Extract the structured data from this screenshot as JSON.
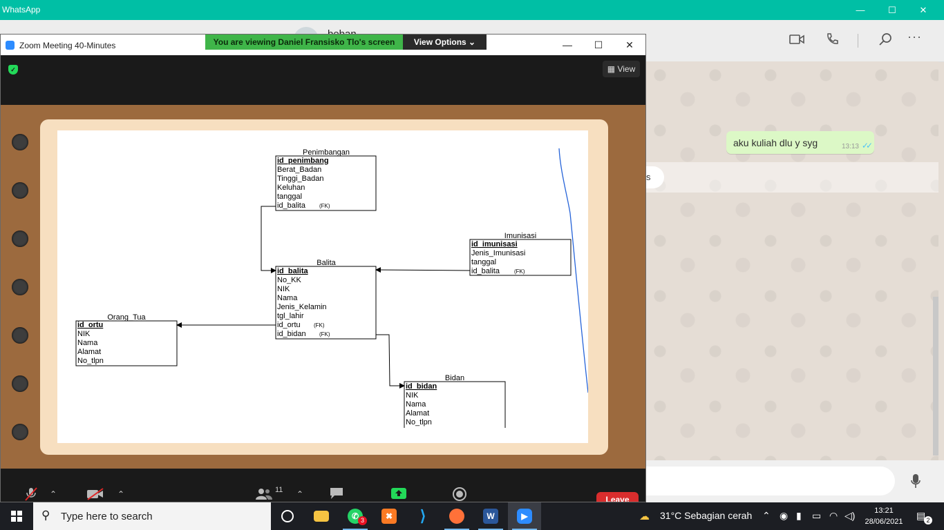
{
  "whatsapp": {
    "title": "WhatsApp",
    "contact_name": "beban",
    "message_text": "aku kuliah dlu y syg",
    "message_time": "13:13",
    "ticks": "✓✓",
    "strip_text": "s",
    "icons": [
      "video-call-icon",
      "voice-call-icon",
      "search-icon",
      "menu-icon",
      "mic-icon"
    ]
  },
  "zoom": {
    "title": "Zoom Meeting 40-Minutes",
    "share_banner": "You are viewing Daniel Fransisko Tlo's screen",
    "view_options": "View Options",
    "view_button": "View",
    "participants_count": "11",
    "leave_button": "Leave"
  },
  "erd": {
    "penimbangan": {
      "title": "Penimbangan",
      "pk": "id_penimbang",
      "fields": [
        "Berat_Badan",
        "Tinggi_Badan",
        "Keluhan",
        "tanggal"
      ],
      "fk": "id_balita",
      "fk_tag": "(FK)"
    },
    "imunisasi": {
      "title": "Imunisasi",
      "pk": "id_imunisasi",
      "fields": [
        "Jenis_Imunisasi",
        "tanggal"
      ],
      "fk": "id_balita",
      "fk_tag": "(FK)"
    },
    "balita": {
      "title": "Balita",
      "pk": "id_balita",
      "fields": [
        "No_KK",
        "NIK",
        "Nama",
        "Jenis_Kelamin",
        "tgl_lahir"
      ],
      "fk1": "id_ortu",
      "fk2": "id_bidan",
      "fk_tag": "(FK)"
    },
    "orang_tua": {
      "title": "Orang_Tua",
      "pk": "id_ortu",
      "fields": [
        "NIK",
        "Nama",
        "Alamat",
        "No_tlpn"
      ]
    },
    "bidan": {
      "title": "Bidan",
      "pk": "id_bidan",
      "fields": [
        "NIK",
        "Nama",
        "Alamat",
        "No_tlpn"
      ]
    }
  },
  "taskbar": {
    "search_placeholder": "Type here to search",
    "whatsapp_badge": "3",
    "weather": "31°C  Sebagian cerah",
    "time": "13:21",
    "date": "28/06/2021",
    "notifications": "2"
  },
  "colors": {
    "whatsapp_teal": "#00bfa5",
    "zoom_green": "#3fb549",
    "leave_red": "#d92d2d",
    "notepad_brown": "#9c6a3e"
  }
}
